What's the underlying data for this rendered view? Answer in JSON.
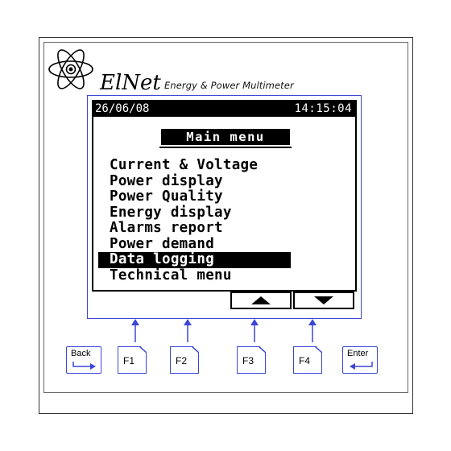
{
  "brand": {
    "name": "ElNet",
    "tagline": "Energy & Power Multimeter",
    "logo_icon": "atom-icon"
  },
  "screen": {
    "status": {
      "date": "26/06/08",
      "time": "14:15:04"
    },
    "menu_title": "Main menu",
    "menu_items": [
      {
        "label": "Current & Voltage",
        "selected": false
      },
      {
        "label": "Power display",
        "selected": false
      },
      {
        "label": "Power Quality",
        "selected": false
      },
      {
        "label": "Energy display",
        "selected": false
      },
      {
        "label": "Alarms report",
        "selected": false
      },
      {
        "label": "Power demand",
        "selected": false
      },
      {
        "label": "Data logging",
        "selected": true
      },
      {
        "label": "Technical menu",
        "selected": false
      }
    ],
    "softkeys": [
      {
        "icon": "triangle-up-icon",
        "key": "F3"
      },
      {
        "icon": "triangle-down-icon",
        "key": "F4"
      }
    ]
  },
  "buttons": {
    "back": "Back",
    "f1": "F1",
    "f2": "F2",
    "f3": "F3",
    "f4": "F4",
    "enter": "Enter"
  },
  "colors": {
    "accent_blue": "#3b46d6",
    "lcd_fg": "#000000",
    "lcd_bg": "#ffffff"
  }
}
